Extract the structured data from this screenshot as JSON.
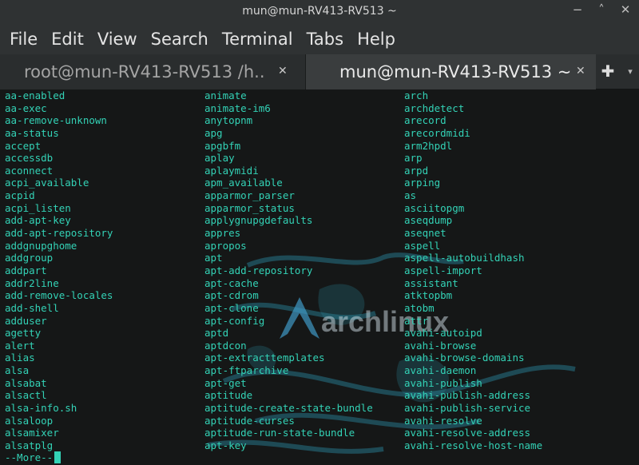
{
  "window": {
    "title": "mun@mun-RV413-RV513 ~",
    "minimize_glyph": "−",
    "maximize_glyph": "˄",
    "close_glyph": "✕"
  },
  "menu": [
    "File",
    "Edit",
    "View",
    "Search",
    "Terminal",
    "Tabs",
    "Help"
  ],
  "tabs": [
    {
      "label": "root@mun-RV413-RV513 /h...",
      "close": "✕",
      "active": false
    },
    {
      "label": "mun@mun-RV413-RV513 ~",
      "close": "✕",
      "active": true
    }
  ],
  "new_tab": "✚",
  "tab_menu": "▾",
  "terminal": {
    "columns": [
      [
        "aa-enabled",
        "aa-exec",
        "aa-remove-unknown",
        "aa-status",
        "accept",
        "accessdb",
        "aconnect",
        "acpi_available",
        "acpid",
        "acpi_listen",
        "add-apt-key",
        "add-apt-repository",
        "addgnupghome",
        "addgroup",
        "addpart",
        "addr2line",
        "add-remove-locales",
        "add-shell",
        "adduser",
        "agetty",
        "alert",
        "alias",
        "alsa",
        "alsabat",
        "alsactl",
        "alsa-info.sh",
        "alsaloop",
        "alsamixer",
        "alsatplg"
      ],
      [
        "animate",
        "animate-im6",
        "anytopnm",
        "apg",
        "apgbfm",
        "aplay",
        "aplaymidi",
        "apm_available",
        "apparmor_parser",
        "apparmor_status",
        "applygnupgdefaults",
        "appres",
        "apropos",
        "apt",
        "apt-add-repository",
        "apt-cache",
        "apt-cdrom",
        "apt-clone",
        "apt-config",
        "aptd",
        "aptdcon",
        "apt-extracttemplates",
        "apt-ftparchive",
        "apt-get",
        "aptitude",
        "aptitude-create-state-bundle",
        "aptitude-curses",
        "aptitude-run-state-bundle",
        "apt-key"
      ],
      [
        "arch",
        "archdetect",
        "arecord",
        "arecordmidi",
        "arm2hpdl",
        "arp",
        "arpd",
        "arping",
        "as",
        "asciitopgm",
        "aseqdump",
        "aseqnet",
        "aspell",
        "aspell-autobuildhash",
        "aspell-import",
        "assistant",
        "atktopbm",
        "atobm",
        "attr",
        "avahi-autoipd",
        "avahi-browse",
        "avahi-browse-domains",
        "avahi-daemon",
        "avahi-publish",
        "avahi-publish-address",
        "avahi-publish-service",
        "avahi-resolve",
        "avahi-resolve-address",
        "avahi-resolve-host-name"
      ]
    ],
    "pager_prompt": "--More--",
    "wallpaper_text": "archlinux",
    "text_color": "#33d2b6",
    "background_color": "#151717"
  }
}
